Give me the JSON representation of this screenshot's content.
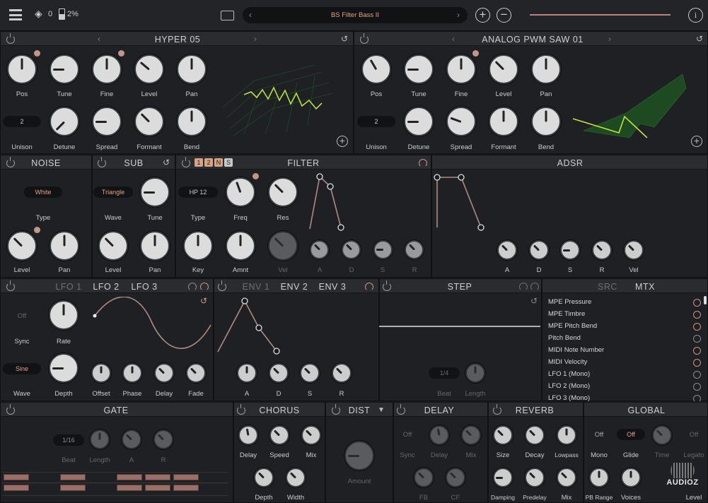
{
  "topbar": {
    "layers_count": "0",
    "cpu": "2%",
    "preset_name": "BS Filter Bass II"
  },
  "osc1": {
    "title": "HYPER 05",
    "knobs": [
      "Pos",
      "Tune",
      "Fine",
      "Level",
      "Pan",
      "Detune",
      "Spread",
      "Formant",
      "Bend"
    ],
    "unison_label": "Unison",
    "unison_value": "2"
  },
  "osc2": {
    "title": "ANALOG PWM SAW 01",
    "knobs": [
      "Pos",
      "Tune",
      "Fine",
      "Level",
      "Pan",
      "Detune",
      "Spread",
      "Formant",
      "Bend"
    ],
    "unison_label": "Unison",
    "unison_value": "2"
  },
  "noise": {
    "title": "NOISE",
    "type_value": "White",
    "type_label": "Type",
    "level": "Level",
    "pan": "Pan"
  },
  "sub": {
    "title": "SUB",
    "wave_value": "Triangle",
    "wave_label": "Wave",
    "tune": "Tune",
    "level": "Level",
    "pan": "Pan"
  },
  "filter": {
    "title": "FILTER",
    "slots": [
      "1",
      "2",
      "N",
      "S"
    ],
    "type_value": "HP 12",
    "type_label": "Type",
    "freq": "Freq",
    "res": "Res",
    "key": "Key",
    "amnt": "Amnt",
    "vel": "Vel",
    "env": [
      "A",
      "D",
      "S",
      "R"
    ]
  },
  "adsr": {
    "title": "ADSR",
    "knobs": [
      "A",
      "D",
      "S",
      "R",
      "Vel"
    ]
  },
  "lfo": {
    "tabs": [
      "LFO 1",
      "LFO 2",
      "LFO 3"
    ],
    "sync_value": "Off",
    "sync_label": "Sync",
    "rate": "Rate",
    "wave_value": "Sine",
    "wave_label": "Wave",
    "knobs": [
      "Depth",
      "Offset",
      "Phase",
      "Delay",
      "Fade"
    ]
  },
  "env": {
    "tabs": [
      "ENV 1",
      "ENV 2",
      "ENV 3"
    ],
    "knobs": [
      "A",
      "D",
      "S",
      "R"
    ]
  },
  "step": {
    "title": "STEP",
    "beat_value": "1/4",
    "beat": "Beat",
    "length": "Length"
  },
  "mtx": {
    "tabs": [
      "SRC",
      "MTX"
    ],
    "items": [
      "MPE Pressure",
      "MPE Timbre",
      "MPE Pitch Bend",
      "Pitch Bend",
      "MIDI Note Number",
      "MIDI Velocity",
      "LFO 1 (Mono)",
      "LFO 2 (Mono)",
      "LFO 3 (Mono)"
    ]
  },
  "gate": {
    "title": "GATE",
    "beat_value": "1/16",
    "knobs": [
      "Beat",
      "Length",
      "A",
      "R"
    ]
  },
  "chorus": {
    "title": "CHORUS",
    "knobs": [
      "Delay",
      "Speed",
      "Mix",
      "Depth",
      "Width"
    ]
  },
  "dist": {
    "title": "DIST",
    "amount": "Amount"
  },
  "delay": {
    "title": "DELAY",
    "sync_value": "Off",
    "knobs": [
      "Sync",
      "Delay",
      "Mix",
      "FB",
      "CF"
    ]
  },
  "reverb": {
    "title": "REVERB",
    "knobs": [
      "Size",
      "Decay",
      "Lowpass",
      "Damping",
      "Predelay",
      "Mix"
    ]
  },
  "global": {
    "title": "GLOBAL",
    "mono_value": "Off",
    "glide_value": "Off",
    "legato_value": "Off",
    "knobs": [
      "Mono",
      "Glide",
      "Time",
      "Legato",
      "PB Range",
      "Voices",
      "Level"
    ]
  },
  "watermark": "AUDIOZ"
}
